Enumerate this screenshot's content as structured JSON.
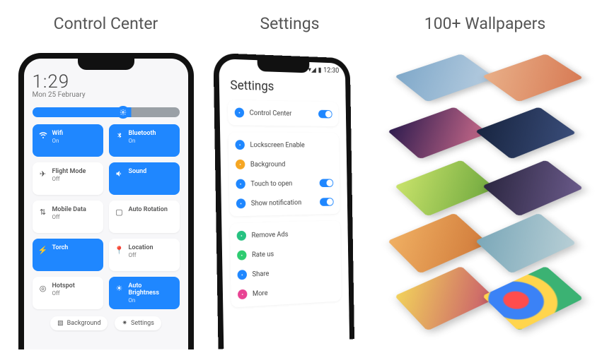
{
  "titles": {
    "control_center": "Control Center",
    "settings": "Settings",
    "wallpapers": "100+ Wallpapers"
  },
  "control_center": {
    "time": "1:29",
    "date": "Mon 25 February",
    "brightness_pct": 67,
    "tiles": [
      {
        "id": "wifi",
        "label": "Wifi",
        "sub": "On",
        "on": true,
        "icon": "wifi-icon"
      },
      {
        "id": "bluetooth",
        "label": "Bluetooth",
        "sub": "On",
        "on": true,
        "icon": "bluetooth-icon"
      },
      {
        "id": "flight",
        "label": "Flight Mode",
        "sub": "Off",
        "on": false,
        "icon": "airplane-icon"
      },
      {
        "id": "sound",
        "label": "Sound",
        "sub": "",
        "on": true,
        "icon": "volume-icon"
      },
      {
        "id": "mobiledata",
        "label": "Mobile Data",
        "sub": "Off",
        "on": false,
        "icon": "signal-icon"
      },
      {
        "id": "autorotation",
        "label": "Auto Rotation",
        "sub": "",
        "on": false,
        "icon": "rotate-icon"
      },
      {
        "id": "torch",
        "label": "Torch",
        "sub": "",
        "on": true,
        "icon": "flashlight-icon"
      },
      {
        "id": "location",
        "label": "Location",
        "sub": "Off",
        "on": false,
        "icon": "pin-icon"
      },
      {
        "id": "hotspot",
        "label": "Hotspot",
        "sub": "Off",
        "on": false,
        "icon": "hotspot-icon"
      },
      {
        "id": "autobright",
        "label": "Auto Brightness",
        "sub": "On",
        "on": true,
        "icon": "brightness-icon"
      }
    ],
    "pills": {
      "background": "Background",
      "settings": "Settings"
    }
  },
  "settings": {
    "status_time": "12:30",
    "title": "Settings",
    "group1": [
      {
        "id": "cc",
        "label": "Control Center",
        "color": "#1f87ff",
        "toggle": true
      }
    ],
    "group2": [
      {
        "id": "lock",
        "label": "Lockscreen Enable",
        "color": "#1f87ff",
        "toggle": false
      },
      {
        "id": "bg",
        "label": "Background",
        "color": "#f5a623",
        "toggle": false
      },
      {
        "id": "touch",
        "label": "Touch to open",
        "color": "#1f87ff",
        "toggle": true
      },
      {
        "id": "notif",
        "label": "Show notification",
        "color": "#1f87ff",
        "toggle": true
      }
    ],
    "group3": [
      {
        "id": "ads",
        "label": "Remove Ads",
        "color": "#26c281"
      },
      {
        "id": "rate",
        "label": "Rate us",
        "color": "#2ecc71"
      },
      {
        "id": "share",
        "label": "Share",
        "color": "#1f87ff"
      },
      {
        "id": "more",
        "label": "More",
        "color": "#e84393"
      }
    ]
  },
  "wallpapers": {
    "rows": [
      [
        "linear-gradient(135deg,#7fa8c9,#b7cde0)",
        "linear-gradient(135deg,#e9b089,#d77a54)"
      ],
      [
        "linear-gradient(135deg,#2d1b4e,#c96a8a)",
        "linear-gradient(135deg,#17243f,#3a4d7a)"
      ],
      [
        "linear-gradient(135deg,#c9e36b,#6fa83e)",
        "linear-gradient(135deg,#2b2640,#6a5a8a)"
      ],
      [
        "linear-gradient(135deg,#f0b063,#d07a3a)",
        "linear-gradient(135deg,#7aa7b8,#b8cfd6)"
      ],
      [
        "linear-gradient(135deg,#f2d35b,#c85a6b)",
        "radial-gradient(circle at 30% 40%,#ff4d4d 0 18%,#3b82f6 20% 40%,#ffd54d 42% 60%,#3bb273 62% 100%)"
      ]
    ]
  }
}
